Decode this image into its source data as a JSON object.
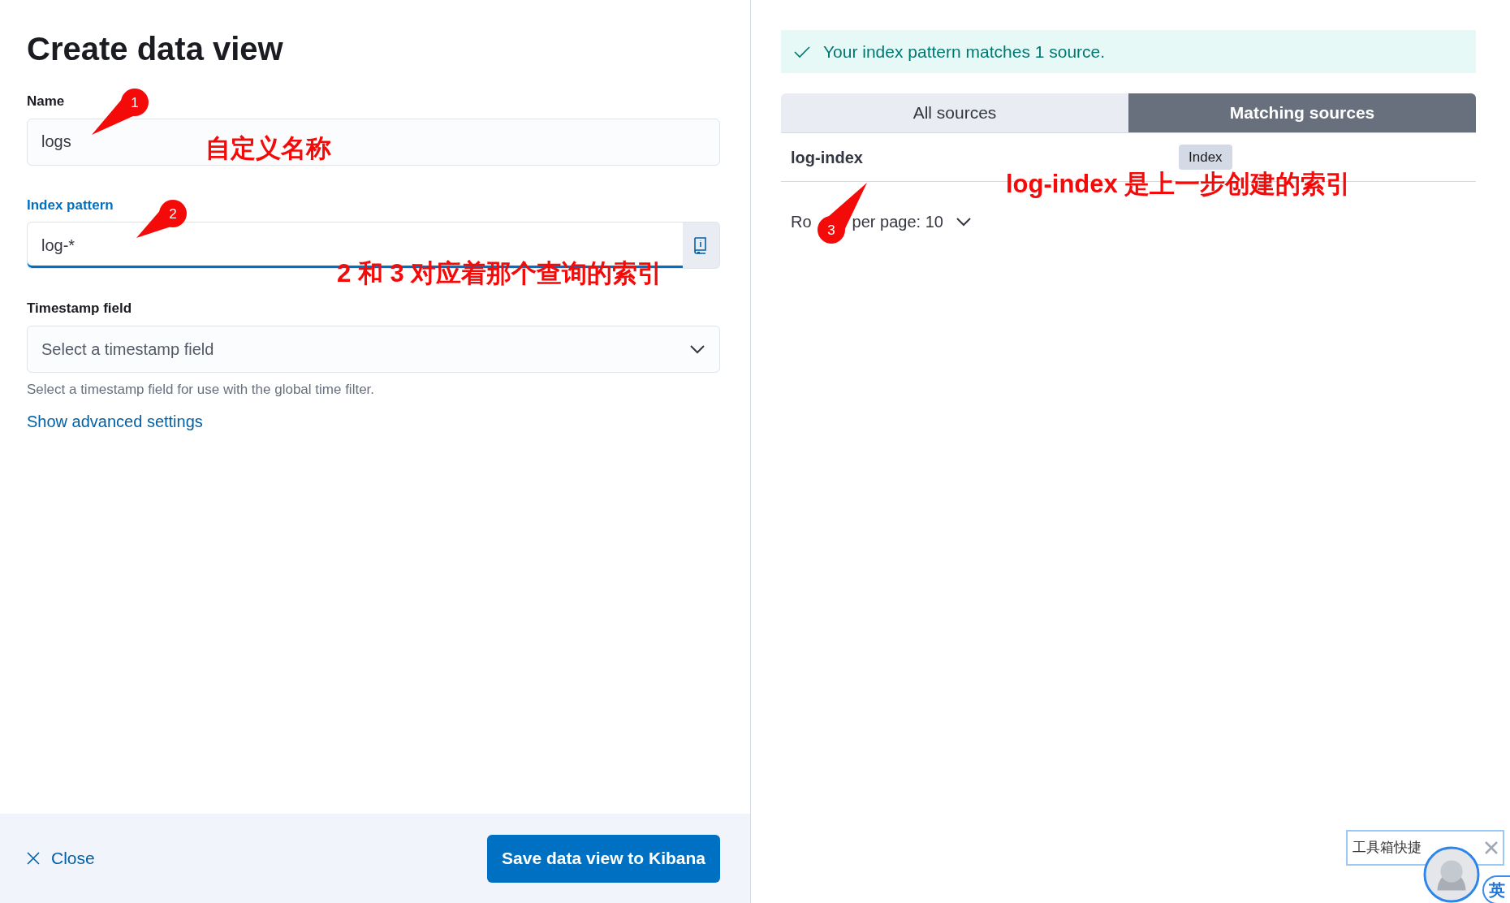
{
  "title": "Create data view",
  "fields": [
    {
      "kind": "text",
      "label": "Name",
      "value": "logs",
      "focused": false
    },
    {
      "kind": "text-with-button",
      "label": "Index pattern",
      "value": "log-*",
      "focused": true
    },
    {
      "kind": "select",
      "label": "Timestamp field",
      "placeholder": "Select a timestamp field",
      "help": "Select a timestamp field for use with the global time filter.",
      "focused": false
    }
  ],
  "advanced_link": "Show advanced settings",
  "footer": {
    "close": "Close",
    "save": "Save data view to Kibana"
  },
  "callout": "Your index pattern matches 1 source.",
  "tabs": [
    {
      "label": "All sources",
      "selected": false
    },
    {
      "label": "Matching sources",
      "selected": true
    }
  ],
  "sources": [
    {
      "name": "log-index",
      "badge": "Index"
    }
  ],
  "pagination": {
    "parts": [
      "Ro",
      "per page: 10"
    ]
  },
  "annotations": [
    {
      "number": "1",
      "note": "自定义名称"
    },
    {
      "number": "2",
      "note": "2 和 3 对应着那个查询的索引"
    },
    {
      "number": "3",
      "note": "log-index 是上一步创建的索引"
    }
  ],
  "widget": {
    "title": "工具箱快捷",
    "badge": "英"
  }
}
